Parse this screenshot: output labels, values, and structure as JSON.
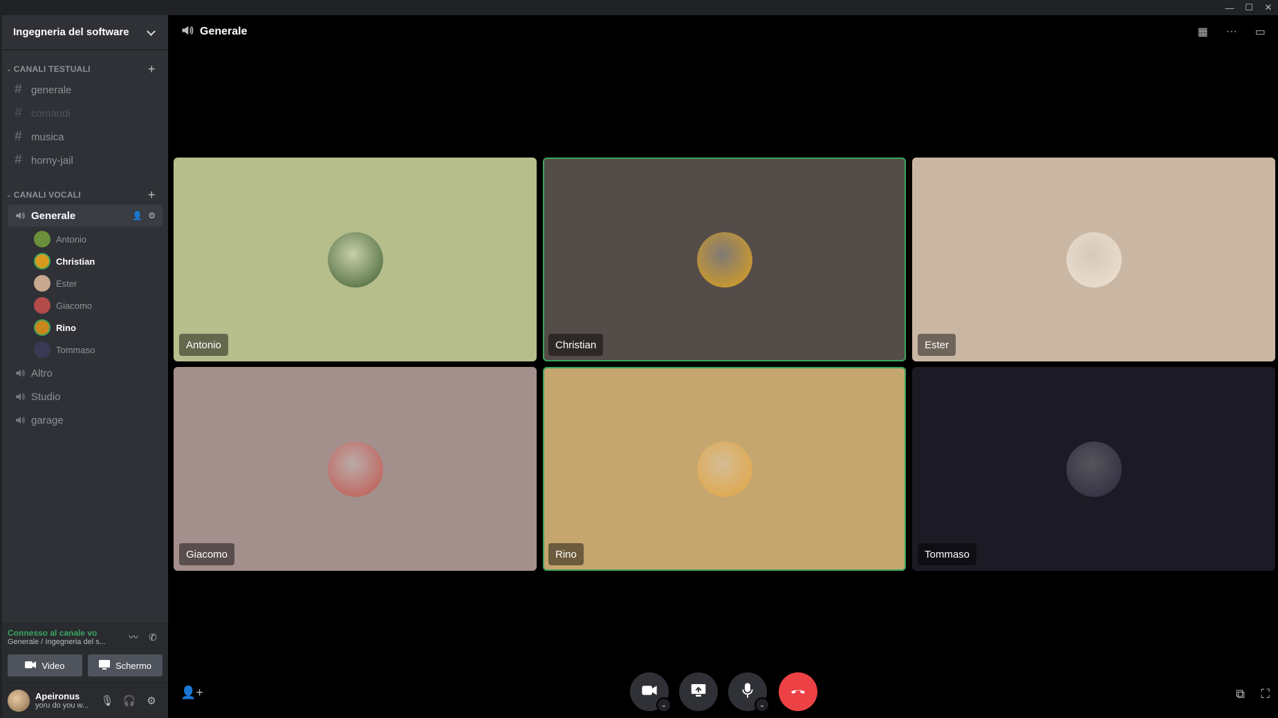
{
  "window": {
    "minimize": "—",
    "maximize": "☐",
    "close": "✕"
  },
  "server": {
    "name": "Ingegneria del software"
  },
  "text_category": {
    "label": "CANALI TESTUALI"
  },
  "text_channels": [
    {
      "name": "generale"
    },
    {
      "name": "comandi"
    },
    {
      "name": "musica"
    },
    {
      "name": "horny-jail"
    }
  ],
  "voice_category": {
    "label": "CANALI VOCALI"
  },
  "voice_active": {
    "name": "Generale"
  },
  "voice_users": [
    {
      "name": "Antonio",
      "speaking": false,
      "color": "#6b8f3a"
    },
    {
      "name": "Christian",
      "speaking": true,
      "color": "#d79a1e"
    },
    {
      "name": "Ester",
      "speaking": false,
      "color": "#c8a98f"
    },
    {
      "name": "Giacomo",
      "speaking": false,
      "color": "#b44b4b"
    },
    {
      "name": "Rino",
      "speaking": true,
      "color": "#c9861d"
    },
    {
      "name": "Tommaso",
      "speaking": false,
      "color": "#3b3a55"
    }
  ],
  "voice_channels": [
    {
      "name": "Altro"
    },
    {
      "name": "Studio"
    },
    {
      "name": "garage"
    }
  ],
  "connection": {
    "status": "Connesso al canale vo",
    "detail": "Generale / Ingegneria del s..."
  },
  "panel_buttons": {
    "video": "Video",
    "screen": "Schermo"
  },
  "user": {
    "name": "Apeironus",
    "status": "yoru do you w..."
  },
  "header": {
    "title": "Generale"
  },
  "tiles": [
    {
      "name": "Antonio",
      "bg": "#b6be8c",
      "speaking": false,
      "avatar": "#3b5e2e"
    },
    {
      "name": "Christian",
      "bg": "#544c48",
      "speaking": true,
      "avatar": "#e0a21a"
    },
    {
      "name": "Ester",
      "bg": "#c9b7a4",
      "speaking": false,
      "avatar": "#efe2d2"
    },
    {
      "name": "Giacomo",
      "bg": "#a38f8c",
      "speaking": false,
      "avatar": "#c2544b"
    },
    {
      "name": "Rino",
      "bg": "#c5a66f",
      "speaking": true,
      "avatar": "#e3a440"
    },
    {
      "name": "Tommaso",
      "bg": "#1c1b25",
      "speaking": false,
      "avatar": "#2c2a3d"
    }
  ]
}
